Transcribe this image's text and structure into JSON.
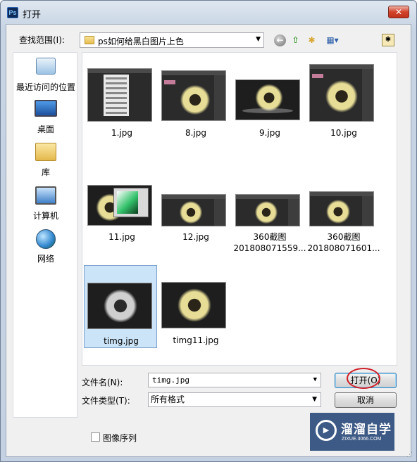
{
  "window": {
    "title": "打开",
    "app_icon": "ps-icon",
    "close_icon": "close-icon"
  },
  "toolbar": {
    "lookin_label": "查找范围(I):",
    "lookin_value": "ps如何给黑白图片上色",
    "icons": [
      "back-icon",
      "up-folder-icon",
      "new-folder-icon",
      "view-menu-icon"
    ]
  },
  "places": [
    {
      "label": "最近访问的位置",
      "icon": "recent-places-icon"
    },
    {
      "label": "桌面",
      "icon": "desktop-icon"
    },
    {
      "label": "库",
      "icon": "library-icon"
    },
    {
      "label": "计算机",
      "icon": "computer-icon"
    },
    {
      "label": "网络",
      "icon": "network-icon"
    }
  ],
  "files": [
    {
      "name": "1.jpg"
    },
    {
      "name": "8.jpg"
    },
    {
      "name": "9.jpg"
    },
    {
      "name": "10.jpg"
    },
    {
      "name": "11.jpg"
    },
    {
      "name": "12.jpg"
    },
    {
      "name_line1": "360截图",
      "name_line2": "201808071559..."
    },
    {
      "name_line1": "360截图",
      "name_line2": "201808071601..."
    },
    {
      "name": "timg.jpg",
      "selected": true
    },
    {
      "name": "timg11.jpg"
    }
  ],
  "form": {
    "filename_label": "文件名(N):",
    "filename_value": "timg.jpg",
    "filetype_label": "文件类型(T):",
    "filetype_value": "所有格式",
    "open_button": "打开(O)",
    "cancel_button": "取消",
    "sequence_label": "图像序列",
    "sequence_checked": false
  },
  "watermark": {
    "brand": "溜溜自学",
    "domain": "ZIXUE.3066.COM"
  }
}
